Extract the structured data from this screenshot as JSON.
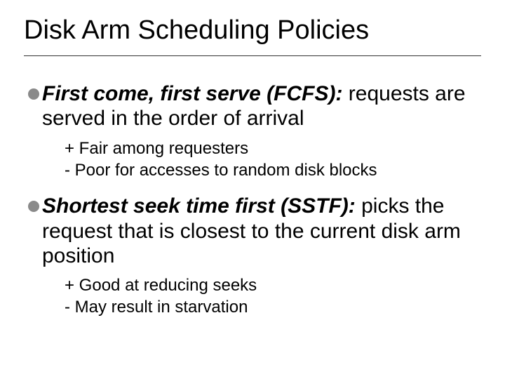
{
  "title": "Disk Arm Scheduling Policies",
  "items": [
    {
      "lead": "First come, first serve (FCFS):",
      "rest": "  requests are served in the order of arrival",
      "subs": [
        "+ Fair among requesters",
        "- Poor for accesses to random disk blocks"
      ]
    },
    {
      "lead": "Shortest seek time first (SSTF):",
      "rest": " picks the request that is closest to the current disk arm position",
      "subs": [
        "+ Good at reducing seeks",
        "- May result in starvation"
      ]
    }
  ]
}
